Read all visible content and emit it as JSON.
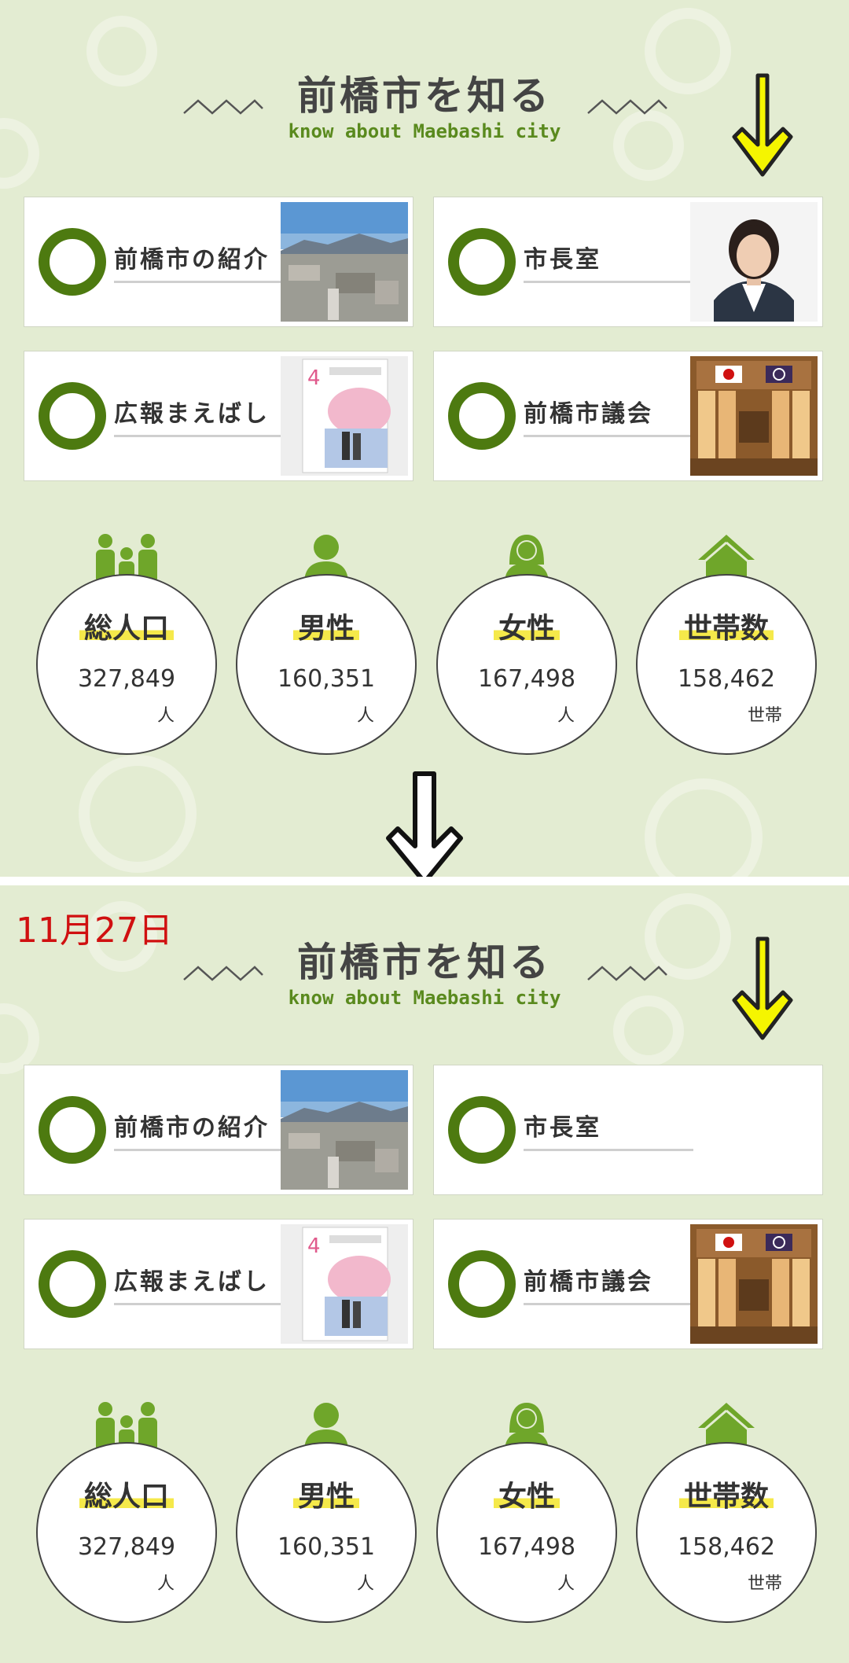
{
  "section": {
    "title_ja": "前橋市を知る",
    "title_en": "know about Maebashi city"
  },
  "cards": {
    "intro": "前橋市の紹介",
    "mayor": "市長室",
    "koho": "広報まえばし",
    "council": "前橋市議会"
  },
  "stats": {
    "total": {
      "label": "総人口",
      "value": "327,849",
      "unit": "人"
    },
    "male": {
      "label": "男性",
      "value": "160,351",
      "unit": "人"
    },
    "female": {
      "label": "女性",
      "value": "167,498",
      "unit": "人"
    },
    "households": {
      "label": "世帯数",
      "value": "158,462",
      "unit": "世帯"
    }
  },
  "annotation": {
    "date": "11月27日"
  },
  "colors": {
    "background": "#e3ecd2",
    "accent_green": "#4d7a10",
    "icon_green": "#6fa62a",
    "highlight_yellow": "#f5e94a",
    "arrow_yellow": "#f5f500",
    "date_red": "#d01010"
  }
}
